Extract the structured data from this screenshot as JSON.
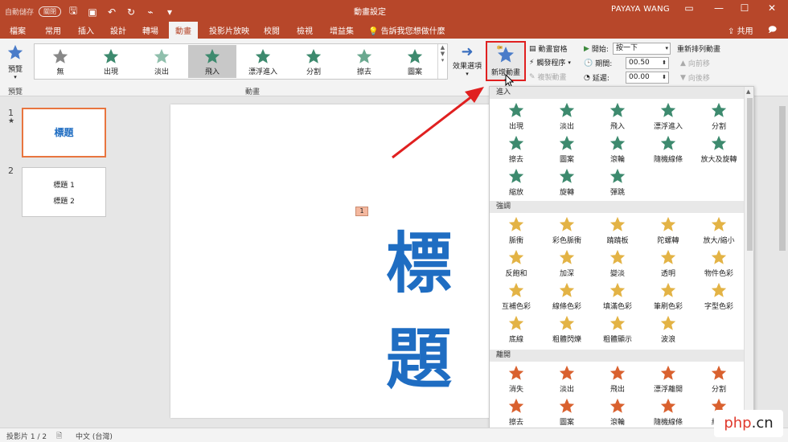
{
  "titlebar": {
    "autosave_label": "自動儲存",
    "autosave_state": "關閉",
    "doc_title": "動畫設定",
    "user": "PAYAYA WANG"
  },
  "tabs": [
    "檔案",
    "常用",
    "插入",
    "設計",
    "轉場",
    "動畫",
    "投影片放映",
    "校閱",
    "檢視",
    "增益集"
  ],
  "active_tab": "動畫",
  "tellme": "告訴我您想做什麼",
  "share": "共用",
  "ribbon": {
    "preview": "預覽",
    "preview_group": "預覽",
    "gallery": [
      "無",
      "出現",
      "淡出",
      "飛入",
      "漂浮進入",
      "分割",
      "擦去",
      "圖案"
    ],
    "gallery_selected": "飛入",
    "animation_group": "動畫",
    "effect_options": "效果選項",
    "add_animation": "新增動畫",
    "animation_pane": "動畫窗格",
    "trigger": "觸發程序",
    "animation_painter": "複製動畫",
    "start_label": "開始:",
    "start_value": "按一下",
    "duration_label": "期間:",
    "duration_value": "00.50",
    "delay_label": "延遲:",
    "delay_value": "00.00",
    "reorder_title": "重新排列動畫",
    "move_earlier": "向前移",
    "move_later": "向後移"
  },
  "slides": {
    "items": [
      {
        "num": "1",
        "marker": "★",
        "lines": [
          "標題"
        ]
      },
      {
        "num": "2",
        "marker": "",
        "lines": [
          "標題 1",
          "標題 2"
        ]
      }
    ]
  },
  "canvas": {
    "title_text": "標題",
    "anim_tag": "1"
  },
  "dropdown": {
    "entrance_label": "進入",
    "entrance": [
      "出現",
      "淡出",
      "飛入",
      "漂浮進入",
      "分割",
      "擦去",
      "圖案",
      "滾輪",
      "隨機線條",
      "放大及旋轉",
      "縮放",
      "旋轉",
      "彈跳"
    ],
    "emphasis_label": "強調",
    "emphasis": [
      "脈衝",
      "彩色脈衝",
      "蹺蹺板",
      "陀螺轉",
      "放大/縮小",
      "反飽和",
      "加深",
      "變淡",
      "透明",
      "物件色彩",
      "互補色彩",
      "線條色彩",
      "填滿色彩",
      "筆刷色彩",
      "字型色彩",
      "底線",
      "粗體閃爍",
      "粗體顯示",
      "波浪"
    ],
    "exit_label": "離開",
    "exit": [
      "消失",
      "淡出",
      "飛出",
      "漂浮離開",
      "分割",
      "擦去",
      "圖案",
      "滾輪",
      "隨機線條",
      "縮小"
    ]
  },
  "status": {
    "slide_info": "投影片 1 / 2",
    "language": "中文 (台灣)"
  },
  "watermark": {
    "brand": "php",
    "rest": ".cn"
  },
  "colors": {
    "titlebar": "#b7472a",
    "accent_red": "#e02020",
    "title_blue": "#1f6dc2",
    "star_entrance": "#3d8a6e",
    "star_emphasis": "#e3b345",
    "star_exit": "#d9612f"
  }
}
